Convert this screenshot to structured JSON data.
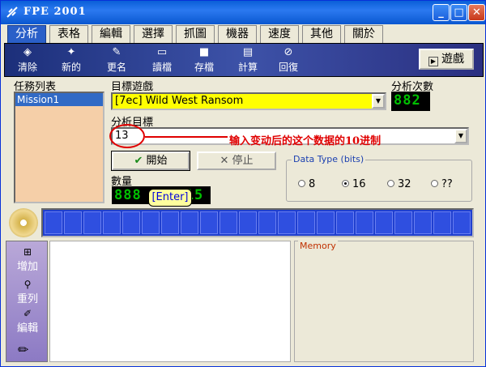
{
  "window": {
    "title": "FPE 2001"
  },
  "tabs": [
    {
      "label": "分析"
    },
    {
      "label": "表格"
    },
    {
      "label": "編輯"
    },
    {
      "label": "選擇"
    },
    {
      "label": "抓圖"
    },
    {
      "label": "機器"
    },
    {
      "label": "速度"
    },
    {
      "label": "其他"
    },
    {
      "label": "關於"
    }
  ],
  "toolbar": {
    "items": [
      {
        "label": "清除",
        "icon": "eraser-icon"
      },
      {
        "label": "新的",
        "icon": "new-icon"
      },
      {
        "label": "更名",
        "icon": "rename-icon"
      },
      {
        "label": "讀檔",
        "icon": "open-folder-icon"
      },
      {
        "label": "存檔",
        "icon": "save-disk-icon"
      },
      {
        "label": "計算",
        "icon": "calculator-icon"
      },
      {
        "label": "回復",
        "icon": "undo-icon"
      }
    ],
    "game_button": "遊戲"
  },
  "task_list": {
    "label": "任務列表",
    "items": [
      "Mission1"
    ]
  },
  "target_game": {
    "label": "目標遊戲",
    "value": "[7ec] Wild West Ransom"
  },
  "analysis_count": {
    "label": "分析次數",
    "value": "882"
  },
  "analysis_target": {
    "label": "分析目標",
    "value": "13"
  },
  "annotation": "输入变动后的这个数据的10进制",
  "buttons": {
    "start": "開始",
    "stop": "停止"
  },
  "quantity": {
    "label": "數量",
    "value": "888",
    "value_suffix": "15"
  },
  "tooltip": "[Enter]",
  "data_type": {
    "legend": "Data Type (bits)",
    "options": [
      {
        "label": "8",
        "selected": false
      },
      {
        "label": "16",
        "selected": true
      },
      {
        "label": "32",
        "selected": false
      },
      {
        "label": "??",
        "selected": false
      }
    ]
  },
  "sidebar": {
    "items": [
      {
        "label": "增加",
        "icon": "add-icon"
      },
      {
        "label": "重列",
        "icon": "relist-icon"
      },
      {
        "label": "編輯",
        "icon": "edit-icon"
      }
    ]
  },
  "memory": {
    "legend": "Memory"
  },
  "colors": {
    "accent": "#2a5fc8",
    "list_bg": "#f5cfa8",
    "combo_highlight": "#ffff00",
    "annotation": "#e00000",
    "lcd_text": "#00c000"
  }
}
